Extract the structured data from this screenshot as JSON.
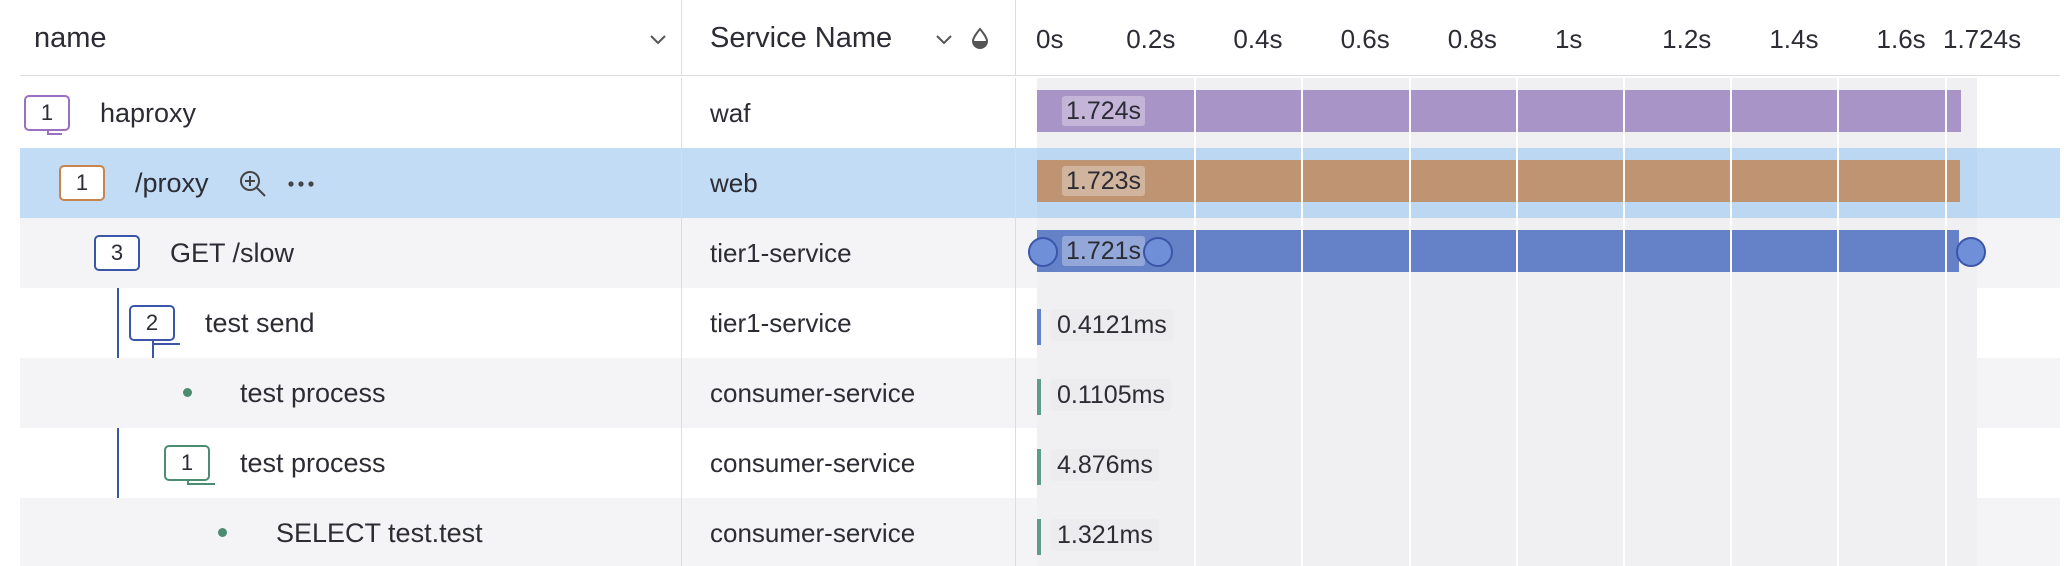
{
  "columns": {
    "name": "name",
    "service": "Service Name"
  },
  "ticks": [
    "0s",
    "0.2s",
    "0.4s",
    "0.6s",
    "0.8s",
    "1s",
    "1.2s",
    "1.4s",
    "1.6s",
    "1.724s"
  ],
  "total_duration_s": 1.724,
  "rows": [
    {
      "count": "1",
      "name": "haproxy",
      "service": "waf",
      "duration": "1.724s",
      "start_s": 0,
      "dur_s": 1.724,
      "color": "#a994c8",
      "border": "#9a6fc4"
    },
    {
      "count": "1",
      "name": "/proxy",
      "service": "web",
      "duration": "1.723s",
      "start_s": 0,
      "dur_s": 1.723,
      "color": "#be9473",
      "border": "#c9844e",
      "selected": true
    },
    {
      "count": "3",
      "name": "GET /slow",
      "service": "tier1-service",
      "duration": "1.721s",
      "start_s": 0,
      "dur_s": 1.721,
      "color": "#6582c9",
      "border": "#3b56a8"
    },
    {
      "count": "2",
      "name": "test send",
      "service": "tier1-service",
      "duration": "0.4121ms",
      "color": "#6582c9",
      "border": "#3b56a8"
    },
    {
      "count": "",
      "name": "test process",
      "service": "consumer-service",
      "duration": "0.1105ms",
      "color": "#5f9b86",
      "border": "#4c8d72"
    },
    {
      "count": "1",
      "name": "test process",
      "service": "consumer-service",
      "duration": "4.876ms",
      "color": "#5f9b86",
      "border": "#4c8d72"
    },
    {
      "count": "",
      "name": "SELECT test.test",
      "service": "consumer-service",
      "duration": "1.321ms",
      "color": "#5f9b86",
      "border": "#4c8d72"
    }
  ]
}
